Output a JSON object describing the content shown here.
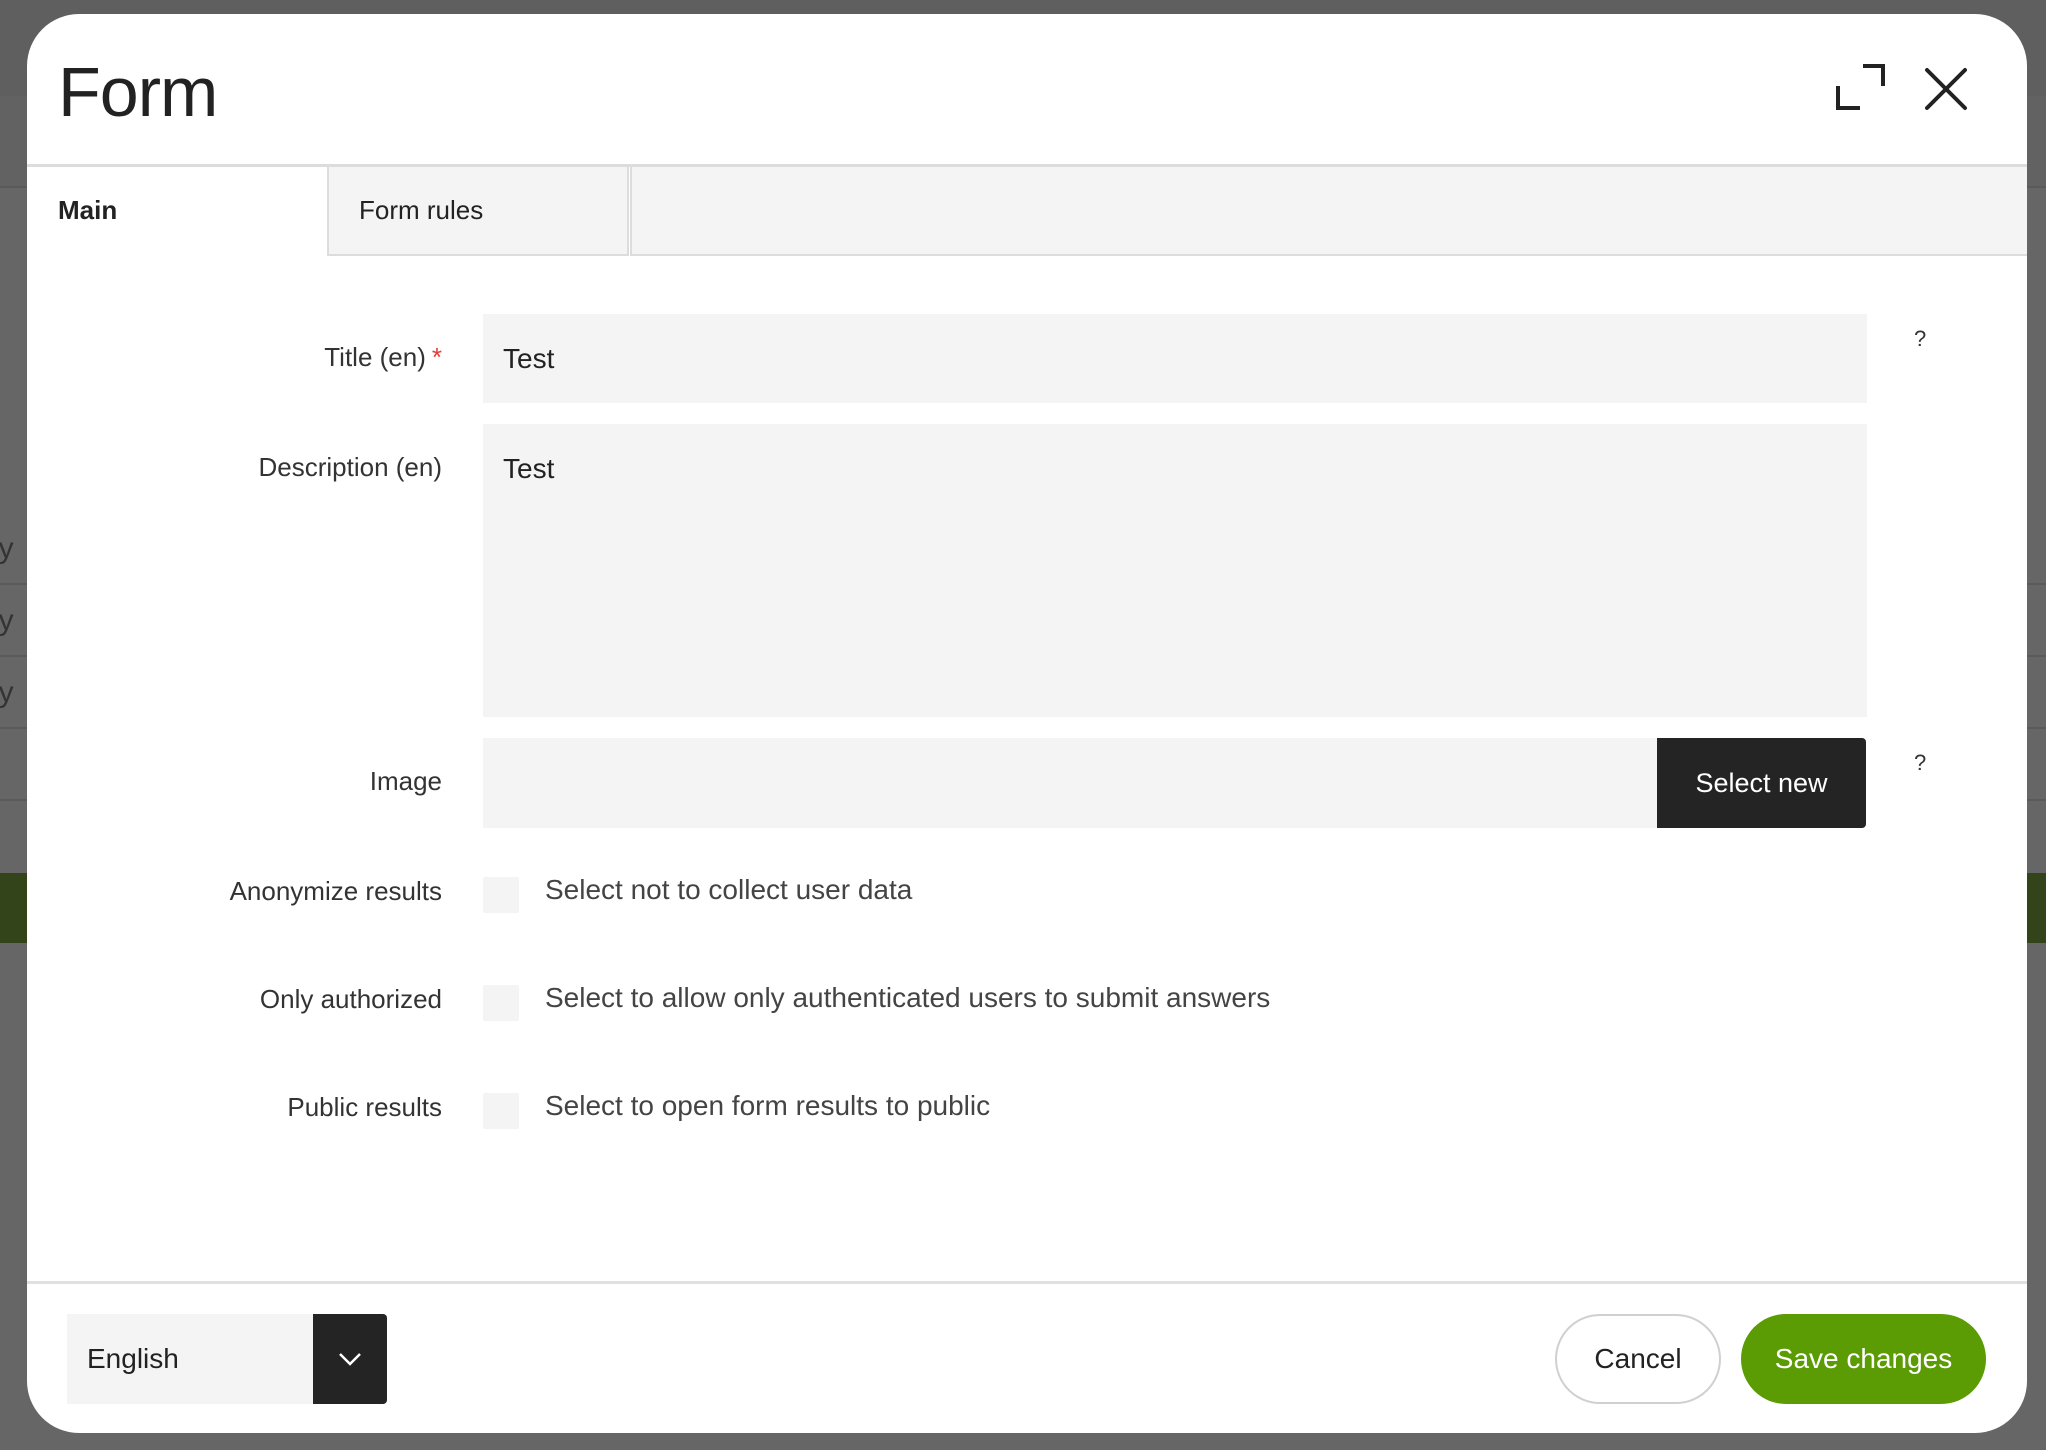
{
  "background": {
    "row_fragments": [
      "ny",
      "ny",
      "ny"
    ]
  },
  "modal": {
    "title": "Form",
    "expand_icon": "expand-icon",
    "close_icon": "close-icon"
  },
  "tabs": [
    {
      "label": "Main",
      "active": true
    },
    {
      "label": "Form rules",
      "active": false
    }
  ],
  "fields": {
    "title": {
      "label": "Title (en)",
      "required_mark": "*",
      "value": "Test",
      "help": "?"
    },
    "description": {
      "label": "Description (en)",
      "value": "Test"
    },
    "image": {
      "label": "Image",
      "value": "",
      "button_label": "Select new",
      "help": "?"
    },
    "anonymize": {
      "label": "Anonymize results",
      "checked": false,
      "text": "Select not to collect user data"
    },
    "only_authorized": {
      "label": "Only authorized",
      "checked": false,
      "text": "Select to allow only authenticated users to submit answers"
    },
    "public_results": {
      "label": "Public results",
      "checked": false,
      "text": "Select to open form results to public"
    }
  },
  "footer": {
    "language": {
      "selected": "English"
    },
    "cancel_label": "Cancel",
    "save_label": "Save changes"
  },
  "colors": {
    "primary_green": "#5b9b04",
    "dark_button": "#242424",
    "required_red": "#e53935",
    "input_bg": "#f4f4f4"
  }
}
